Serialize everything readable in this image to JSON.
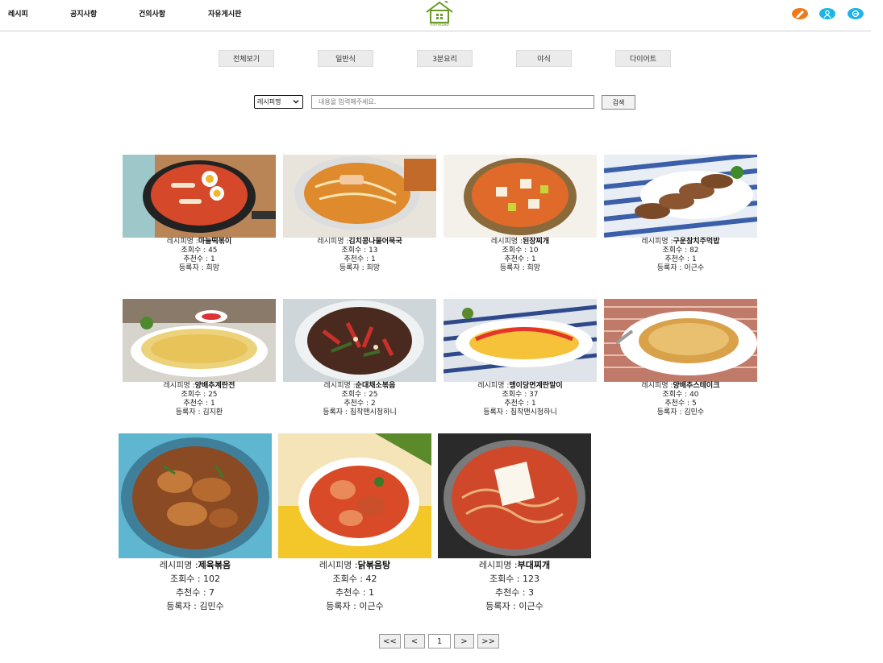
{
  "nav": {
    "items": [
      "레시피",
      "공지사항",
      "건의사항",
      "자유게시판"
    ],
    "logo_text": "homebab",
    "icons": [
      "pencil-icon",
      "user-icon",
      "logout-icon"
    ],
    "icon_colors": {
      "pencil": "#f07a1a",
      "user": "#1fb4e6",
      "logout": "#1fb4e6"
    }
  },
  "categories": [
    "전체보기",
    "일반식",
    "3분요리",
    "야식",
    "다이어트"
  ],
  "search": {
    "select_value": "레시피명",
    "placeholder": "내용을 입력해주세요.",
    "button": "검색"
  },
  "labels": {
    "name": "레시피명",
    "views": "조회수",
    "recs": "추천수",
    "author": "등록자"
  },
  "recipes": [
    {
      "name": "마늘떡볶이",
      "views": "45",
      "recs": "1",
      "author": "희망"
    },
    {
      "name": "김치콩나물어묵국",
      "views": "13",
      "recs": "1",
      "author": "희망"
    },
    {
      "name": "된장찌개",
      "views": "10",
      "recs": "1",
      "author": "희망"
    },
    {
      "name": "구운참치주먹밥",
      "views": "82",
      "recs": "1",
      "author": "이근수"
    },
    {
      "name": "양배추계란전",
      "views": "25",
      "recs": "1",
      "author": "김지환"
    },
    {
      "name": "순대채소볶음",
      "views": "25",
      "recs": "2",
      "author": "침착맨시청하니"
    },
    {
      "name": "맹이당면계란말이",
      "views": "37",
      "recs": "1",
      "author": "침착맨시청하니"
    },
    {
      "name": "양배추스테이크",
      "views": "40",
      "recs": "5",
      "author": "김민수"
    },
    {
      "name": "제육볶음",
      "views": "102",
      "recs": "7",
      "author": "김민수"
    },
    {
      "name": "닭볶음탕",
      "views": "42",
      "recs": "1",
      "author": "이근수"
    },
    {
      "name": "부대찌개",
      "views": "123",
      "recs": "3",
      "author": "이근수"
    }
  ],
  "pagination": [
    "<<",
    "<",
    "1",
    ">",
    ">>"
  ]
}
